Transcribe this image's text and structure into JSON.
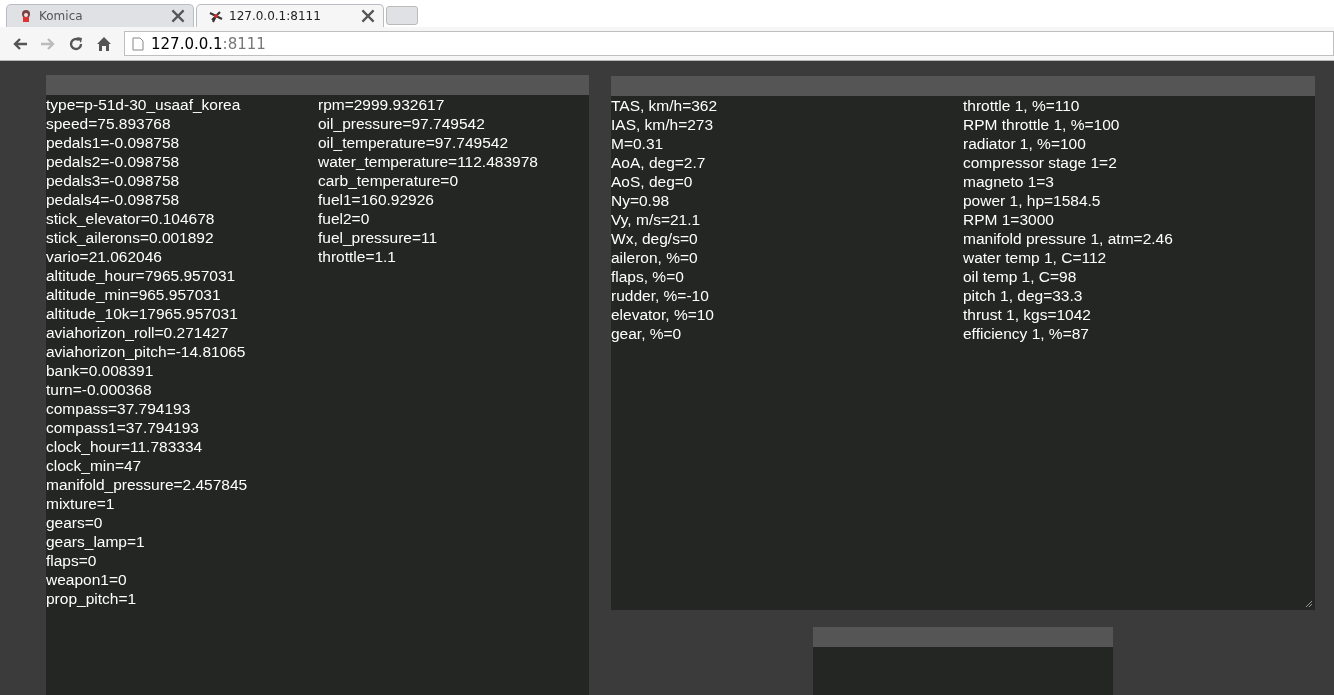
{
  "tabs": [
    {
      "title": "Komica",
      "selected": false
    },
    {
      "title": "127.0.0.1:8111",
      "selected": true
    }
  ],
  "toolbar": {
    "buttons": [
      {
        "kind": "back",
        "disabled": false
      },
      {
        "kind": "forward",
        "disabled": true
      },
      {
        "kind": "reload",
        "disabled": false
      },
      {
        "kind": "home",
        "disabled": false
      }
    ],
    "address": {
      "host": "127.0.0.1",
      "port": ":8111"
    }
  },
  "panels": [
    {
      "kind": "indicators",
      "columns": [
        [
          "type=p-51d-30_usaaf_korea",
          "speed=75.893768",
          "pedals1=-0.098758",
          "pedals2=-0.098758",
          "pedals3=-0.098758",
          "pedals4=-0.098758",
          "stick_elevator=0.104678",
          "stick_ailerons=0.001892",
          "vario=21.062046",
          "altitude_hour=7965.957031",
          "altitude_min=965.957031",
          "altitude_10k=17965.957031",
          "aviahorizon_roll=0.271427",
          "aviahorizon_pitch=-14.81065",
          "bank=0.008391",
          "turn=-0.000368",
          "compass=37.794193",
          "compass1=37.794193",
          "clock_hour=11.783334",
          "clock_min=47",
          "manifold_pressure=2.457845",
          "mixture=1",
          "gears=0",
          "gears_lamp=1",
          "flaps=0",
          "weapon1=0",
          "prop_pitch=1"
        ],
        [
          "rpm=2999.932617",
          "oil_pressure=97.749542",
          "oil_temperature=97.749542",
          "water_temperature=112.483978",
          "carb_temperature=0",
          "fuel1=160.92926",
          "fuel2=0",
          "fuel_pressure=11",
          "throttle=1.1"
        ]
      ]
    },
    {
      "kind": "state",
      "columns": [
        [
          "TAS, km/h=362",
          "IAS, km/h=273",
          "M=0.31",
          "AoA, deg=2.7",
          "AoS, deg=0",
          "Ny=0.98",
          "Vy, m/s=21.1",
          "Wx, deg/s=0",
          "aileron, %=0",
          "flaps, %=0",
          "rudder, %=-10",
          "elevator, %=10",
          "gear, %=0"
        ],
        [
          "throttle 1, %=110",
          "RPM throttle 1, %=100",
          "radiator 1, %=100",
          "compressor stage 1=2",
          "magneto 1=3",
          "power 1, hp=1584.5",
          "RPM 1=3000",
          "manifold pressure 1, atm=2.46",
          "water temp 1, C=112",
          "oil temp 1, C=98",
          "pitch 1, deg=33.3",
          "thrust 1, kgs=1042",
          "efficiency 1, %=87"
        ]
      ]
    },
    {
      "kind": "map"
    }
  ]
}
